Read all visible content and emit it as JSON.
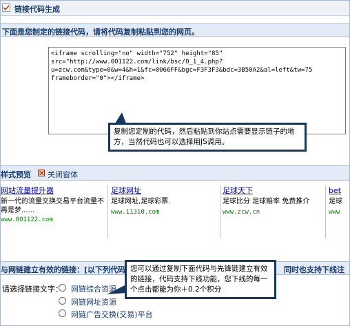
{
  "window": {
    "title": "链接代码生成"
  },
  "code_section": {
    "header": "下面是您制定的链接代码，请将代码复制粘贴到您的网页。",
    "code_lines": [
      "<iframe scrolling=\"no\" width=\"752\" height=\"85\"",
      "src=\"http://www.001122.com/link/bsc/0_1_4.php?",
      "u=zcw.com&type=0&w=4&h=1&fc=0066FF&bgc=F3F3F3&bdc=3B50A2&al=left&tw=75",
      "frameborder=\"0\"></iframe>"
    ],
    "callout": "复制您定制的代码，然后粘贴到你站点需要显示链子的地方，当然代码也可以选择用JS调用。"
  },
  "preview": {
    "title": "样式预览",
    "close_label": "关闭窗体",
    "items": [
      {
        "link": "网站流量提升器",
        "desc_line1": "新一代的流量交换交易平台流量不",
        "desc_line2": "再是梦......",
        "url": "www.001122.com"
      },
      {
        "link": "足球网址",
        "desc_line1": "足球网址,足球彩票.",
        "desc_line2": "",
        "url": "www.11310.com"
      },
      {
        "link": "足球天下",
        "desc_line1": "足球比分  足球赔率  免费推介",
        "desc_line2": "",
        "url": "www.zcw.cn"
      },
      {
        "link": "bet",
        "desc_line1": "足球",
        "desc_line2": "",
        "url": "www"
      }
    ]
  },
  "links_section": {
    "header_left": "与网链建立有效的链接：[以下列代码",
    "header_right": "同时也支持下线注",
    "choose_label": "请选择链接文字：",
    "options": [
      "网链综合资源",
      "网链网址资源",
      "网链广告交换(交易)平台"
    ],
    "callout": "您可以通过复制下面代码与先锋链建立有效的链接，代码支持下线功能，您下线的每一个点击都能为你＋0.2个积分"
  },
  "colors": {
    "header_bg": "#e2ebf6",
    "header_text": "#1a3d6e",
    "link": "#0000cc",
    "url": "#008000",
    "callout_border": "#17375e"
  }
}
